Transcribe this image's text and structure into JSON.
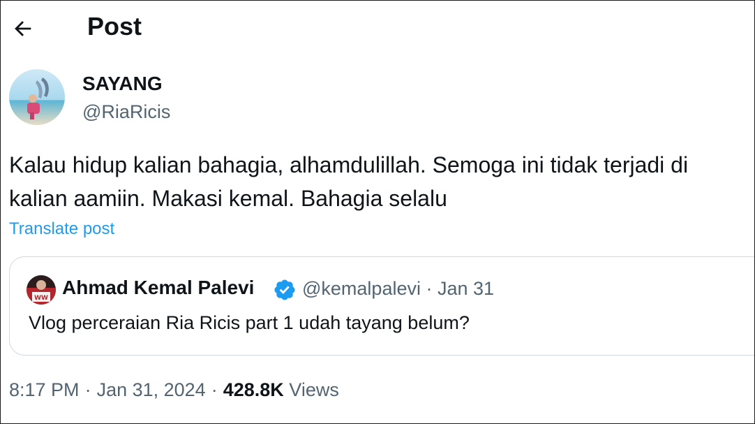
{
  "header": {
    "title": "Post",
    "back_icon": "arrow-left-icon"
  },
  "author": {
    "name": "SAYANG",
    "handle": "@RiaRicis"
  },
  "post": {
    "text_line1": "Kalau hidup kalian bahagia, alhamdulillah. Semoga ini tidak terjadi di",
    "text_line2": "kalian aamiin. Makasi kemal. Bahagia selalu",
    "translate_label": "Translate post"
  },
  "quoted_post": {
    "name": "Ahmad Kemal Palevi",
    "handle_date": "@kemalpalevi · Jan 31",
    "text": "Vlog perceraian Ria Ricis part 1 udah tayang belum?",
    "verified_icon": "verified-badge-icon"
  },
  "meta": {
    "time": "8:17 PM",
    "separator": "·",
    "date": "Jan 31, 2024",
    "views_count": "428.8K",
    "views_label": "Views"
  },
  "colors": {
    "text_primary": "#0f1419",
    "text_secondary": "#536471",
    "link": "#1d9bf0",
    "verified": "#1d9bf0",
    "border": "#cfd9de"
  }
}
